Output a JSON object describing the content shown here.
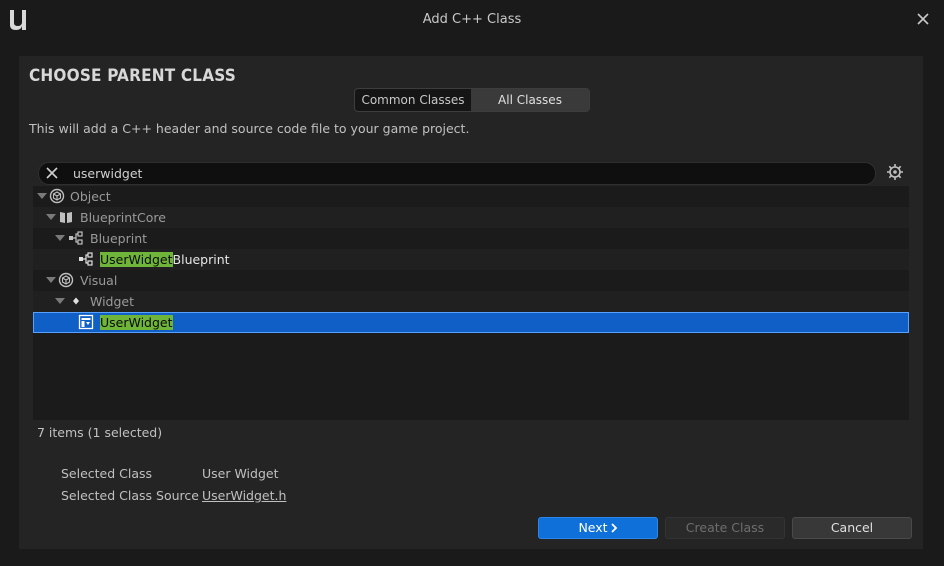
{
  "window": {
    "title": "Add C++ Class"
  },
  "panel": {
    "heading": "CHOOSE PARENT CLASS",
    "tabs": [
      {
        "label": "Common Classes",
        "selected": false
      },
      {
        "label": "All Classes",
        "selected": true
      }
    ],
    "description": "This will add a C++ header and source code file to your game project."
  },
  "search": {
    "value": "userwidget"
  },
  "tree": {
    "rows": [
      {
        "label": "Object",
        "icon": "object-icon",
        "match": "",
        "rest": "Object"
      },
      {
        "label": "BlueprintCore",
        "icon": "book-icon",
        "match": "",
        "rest": "BlueprintCore"
      },
      {
        "label": "Blueprint",
        "icon": "blueprint-icon",
        "match": "",
        "rest": "Blueprint"
      },
      {
        "label": "UserWidgetBlueprint",
        "icon": "blueprint-icon",
        "match": "UserWidget",
        "rest": "Blueprint"
      },
      {
        "label": "Visual",
        "icon": "object-icon",
        "match": "",
        "rest": "Visual"
      },
      {
        "label": "Widget",
        "icon": "diamond-icon",
        "match": "",
        "rest": "Widget"
      },
      {
        "label": "UserWidget",
        "icon": "user-widget-icon",
        "match": "UserWidget",
        "rest": "",
        "selected": true
      }
    ]
  },
  "status": {
    "count": "7 items (1 selected)"
  },
  "info": {
    "selected_class_label": "Selected Class",
    "selected_class_value": "User Widget",
    "selected_source_label": "Selected Class Source",
    "selected_source_value": "UserWidget.h"
  },
  "buttons": {
    "next": "Next",
    "create": "Create Class",
    "cancel": "Cancel"
  },
  "colors": {
    "accent": "#0e70d8",
    "selection": "#0f5fc7",
    "highlight": "#6fb53a"
  }
}
